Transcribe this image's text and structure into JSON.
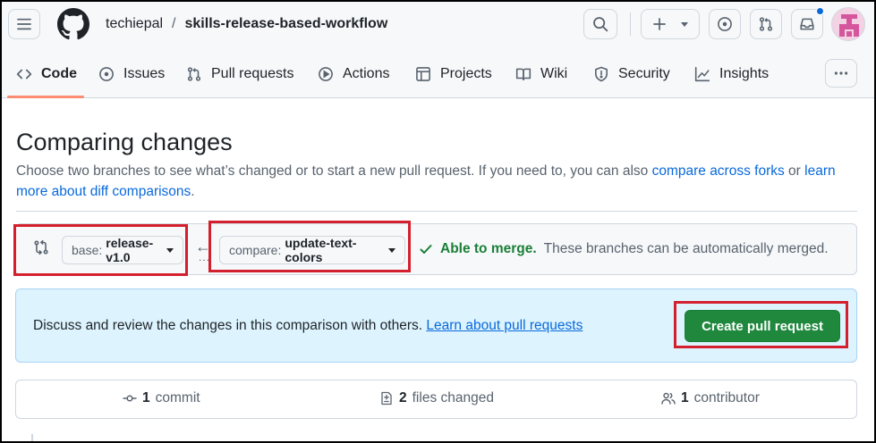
{
  "header": {
    "owner": "techiepal",
    "separator": "/",
    "repo": "skills-release-based-workflow",
    "icons": [
      "menu-icon",
      "github-logo",
      "search-icon",
      "plus-icon",
      "issue-opened-icon",
      "git-pull-request-icon",
      "inbox-icon"
    ]
  },
  "tabs": [
    {
      "label": "Code",
      "icon": "code-icon",
      "active": true
    },
    {
      "label": "Issues",
      "icon": "issue-opened-icon"
    },
    {
      "label": "Pull requests",
      "icon": "git-pull-request-icon"
    },
    {
      "label": "Actions",
      "icon": "play-icon"
    },
    {
      "label": "Projects",
      "icon": "table-icon"
    },
    {
      "label": "Wiki",
      "icon": "book-icon"
    },
    {
      "label": "Security",
      "icon": "shield-icon"
    },
    {
      "label": "Insights",
      "icon": "graph-icon"
    }
  ],
  "page": {
    "title": "Comparing changes",
    "desc_prefix": "Choose two branches to see what’s changed or to start a new pull request. If you need to, you can also ",
    "desc_link1": "compare across forks",
    "desc_mid": " or ",
    "desc_link2": "learn more about diff comparisons",
    "desc_suffix": "."
  },
  "range": {
    "base_prefix": "base:",
    "base_value": "release-v1.0",
    "compare_prefix": "compare:",
    "compare_value": "update-text-colors",
    "merge_ok": "Able to merge.",
    "merge_detail": "These branches can be automatically merged."
  },
  "flash": {
    "text": "Discuss and review the changes in this comparison with others.",
    "link": "Learn about pull requests",
    "button": "Create pull request"
  },
  "stats": {
    "commits_count": "1",
    "commits_label": "commit",
    "files_count": "2",
    "files_label": "files changed",
    "contributors_count": "1",
    "contributors_label": "contributor"
  },
  "colors": {
    "accent": "#0969da",
    "success": "#1a7f37",
    "button_green": "#1f883d",
    "highlight_red": "#d4202e",
    "tab_underline": "#fd8c73"
  }
}
